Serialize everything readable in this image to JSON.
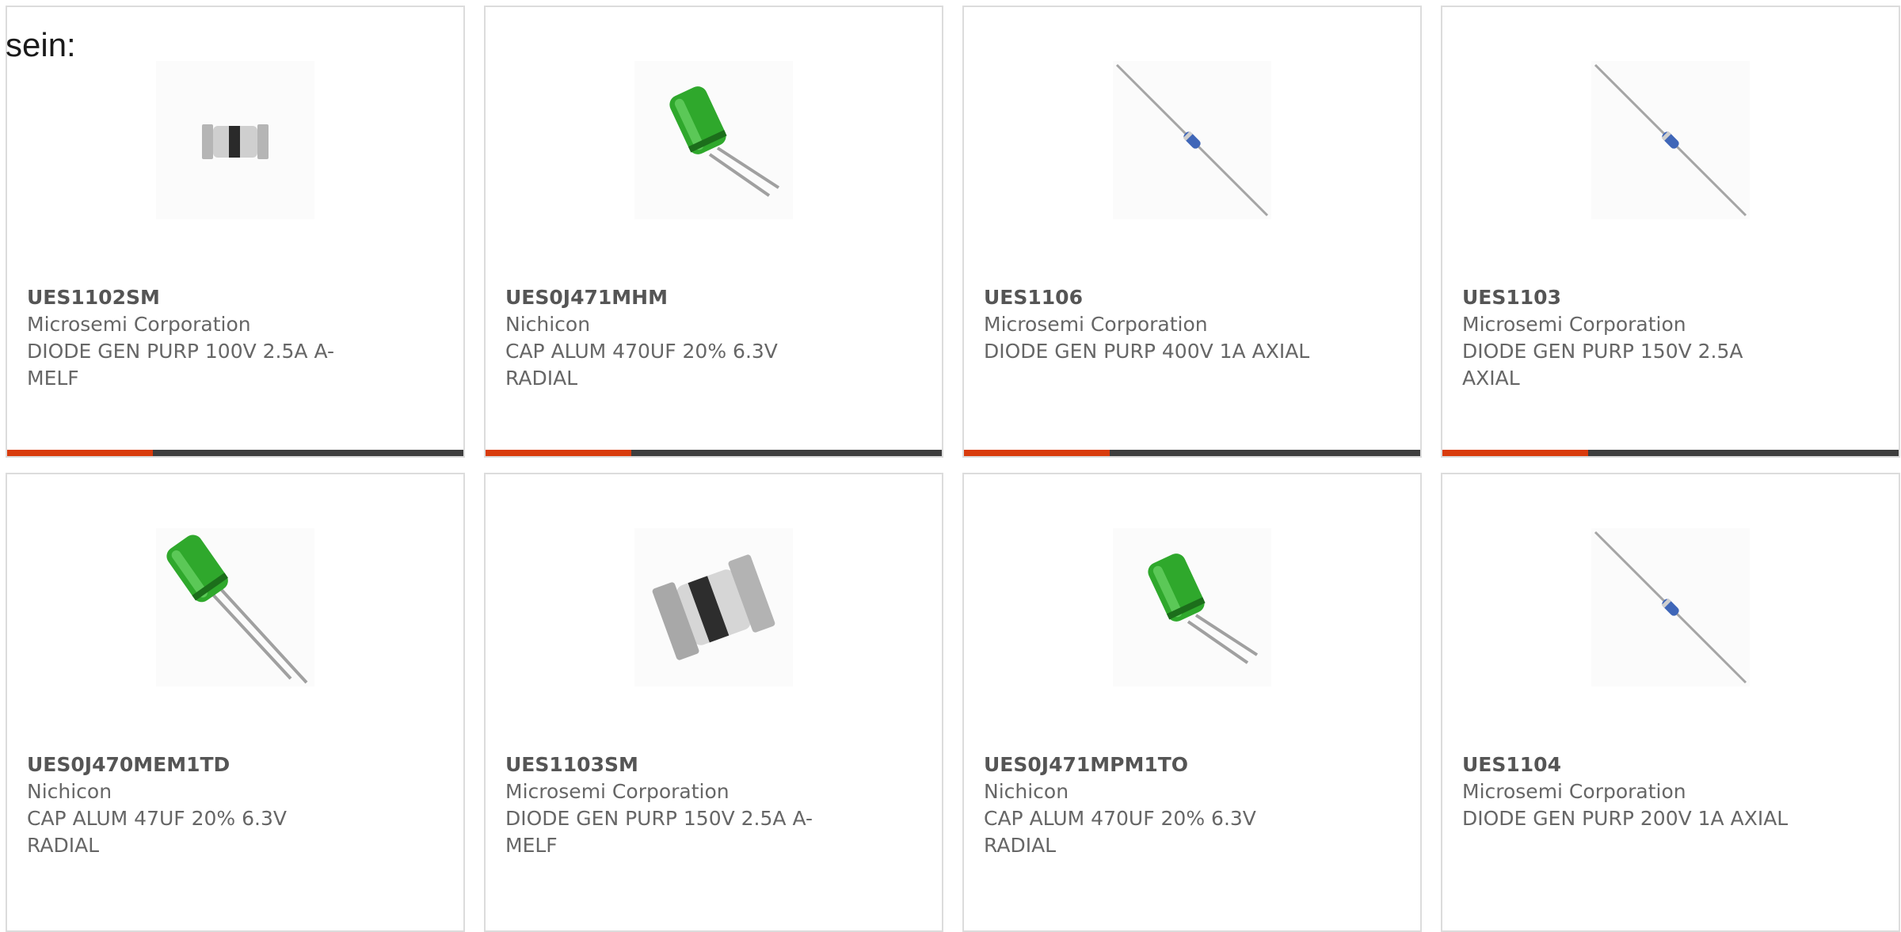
{
  "intro_text": "sein:",
  "colors": {
    "accent": "#d83b0c",
    "bar_track": "#3d3d3d",
    "border": "#dcdcdc",
    "text": "#666666"
  },
  "products": [
    {
      "part": "UES1102SM",
      "manufacturer": "Microsemi Corporation",
      "description": "DIODE GEN PURP 100V 2.5A A-MELF",
      "image": "melf-diode-small",
      "progress": 0.32
    },
    {
      "part": "UES0J471MHM",
      "manufacturer": "Nichicon",
      "description": "CAP ALUM 470UF 20% 6.3V RADIAL",
      "image": "radial-capacitor",
      "progress": 0.32
    },
    {
      "part": "UES1106",
      "manufacturer": "Microsemi Corporation",
      "description": "DIODE GEN PURP 400V 1A AXIAL",
      "image": "axial-diode",
      "progress": 0.32
    },
    {
      "part": "UES1103",
      "manufacturer": "Microsemi Corporation",
      "description": "DIODE GEN PURP 150V 2.5A AXIAL",
      "image": "axial-diode",
      "progress": 0.32
    },
    {
      "part": "UES0J470MEM1TD",
      "manufacturer": "Nichicon",
      "description": "CAP ALUM 47UF 20% 6.3V RADIAL",
      "image": "radial-capacitor-long-leads"
    },
    {
      "part": "UES1103SM",
      "manufacturer": "Microsemi Corporation",
      "description": "DIODE GEN PURP 150V 2.5A A-MELF",
      "image": "melf-diode-large"
    },
    {
      "part": "UES0J471MPM1TO",
      "manufacturer": "Nichicon",
      "description": "CAP ALUM 470UF 20% 6.3V RADIAL",
      "image": "radial-capacitor"
    },
    {
      "part": "UES1104",
      "manufacturer": "Microsemi Corporation",
      "description": "DIODE GEN PURP 200V 1A AXIAL",
      "image": "axial-diode"
    }
  ]
}
